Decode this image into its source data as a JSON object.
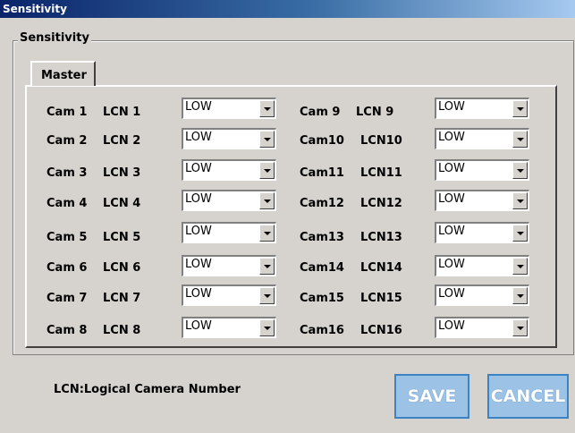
{
  "window": {
    "title": "Sensitivity"
  },
  "group": {
    "label": "Sensitivity"
  },
  "tabs": [
    {
      "label": "Master"
    }
  ],
  "left_rows": [
    {
      "cam": "Cam 1",
      "lcn": "LCN 1",
      "value": "LOW"
    },
    {
      "cam": "Cam 2",
      "lcn": "LCN 2",
      "value": "LOW"
    },
    {
      "cam": "Cam 3",
      "lcn": "LCN 3",
      "value": "LOW"
    },
    {
      "cam": "Cam 4",
      "lcn": "LCN 4",
      "value": "LOW"
    },
    {
      "cam": "Cam 5",
      "lcn": "LCN 5",
      "value": "LOW"
    },
    {
      "cam": "Cam 6",
      "lcn": "LCN 6",
      "value": "LOW"
    },
    {
      "cam": "Cam 7",
      "lcn": "LCN 7",
      "value": "LOW"
    },
    {
      "cam": "Cam 8",
      "lcn": "LCN 8",
      "value": "LOW"
    }
  ],
  "right_rows": [
    {
      "cam": "Cam 9",
      "lcn": "LCN 9",
      "value": "LOW"
    },
    {
      "cam": "Cam10",
      "lcn": "LCN10",
      "value": "LOW"
    },
    {
      "cam": "Cam11",
      "lcn": "LCN11",
      "value": "LOW"
    },
    {
      "cam": "Cam12",
      "lcn": "LCN12",
      "value": "LOW"
    },
    {
      "cam": "Cam13",
      "lcn": "LCN13",
      "value": "LOW"
    },
    {
      "cam": "Cam14",
      "lcn": "LCN14",
      "value": "LOW"
    },
    {
      "cam": "Cam15",
      "lcn": "LCN15",
      "value": "LOW"
    },
    {
      "cam": "Cam16",
      "lcn": "LCN16",
      "value": "LOW"
    }
  ],
  "footnote": "LCN:Logical Camera Number",
  "buttons": {
    "save": "SAVE",
    "cancel": "CANCEL"
  },
  "colors": {
    "titlebar": "#0a246a",
    "button_fill": "#9cc3e6",
    "button_border": "#3b83c2"
  },
  "icons": {
    "combo_arrow": "chevron-down-icon"
  }
}
